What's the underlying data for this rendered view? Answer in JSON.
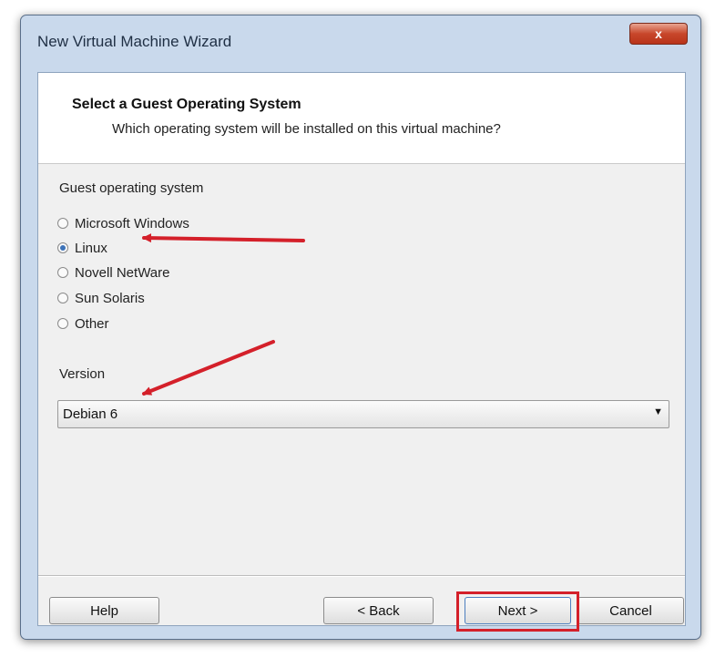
{
  "window": {
    "title": "New Virtual Machine Wizard",
    "close_label": "x"
  },
  "header": {
    "title": "Select a Guest Operating System",
    "subtitle": "Which operating system will be installed on this virtual machine?"
  },
  "guest_os": {
    "label": "Guest operating system",
    "options": [
      "Microsoft Windows",
      "Linux",
      "Novell NetWare",
      "Sun Solaris",
      "Other"
    ],
    "selected": "Linux"
  },
  "version": {
    "label": "Version",
    "value": "Debian 6"
  },
  "buttons": {
    "help": "Help",
    "back": "< Back",
    "next": "Next >",
    "cancel": "Cancel"
  },
  "colors": {
    "annotation": "#d4202a",
    "radio_selected": "#3d72b8"
  }
}
